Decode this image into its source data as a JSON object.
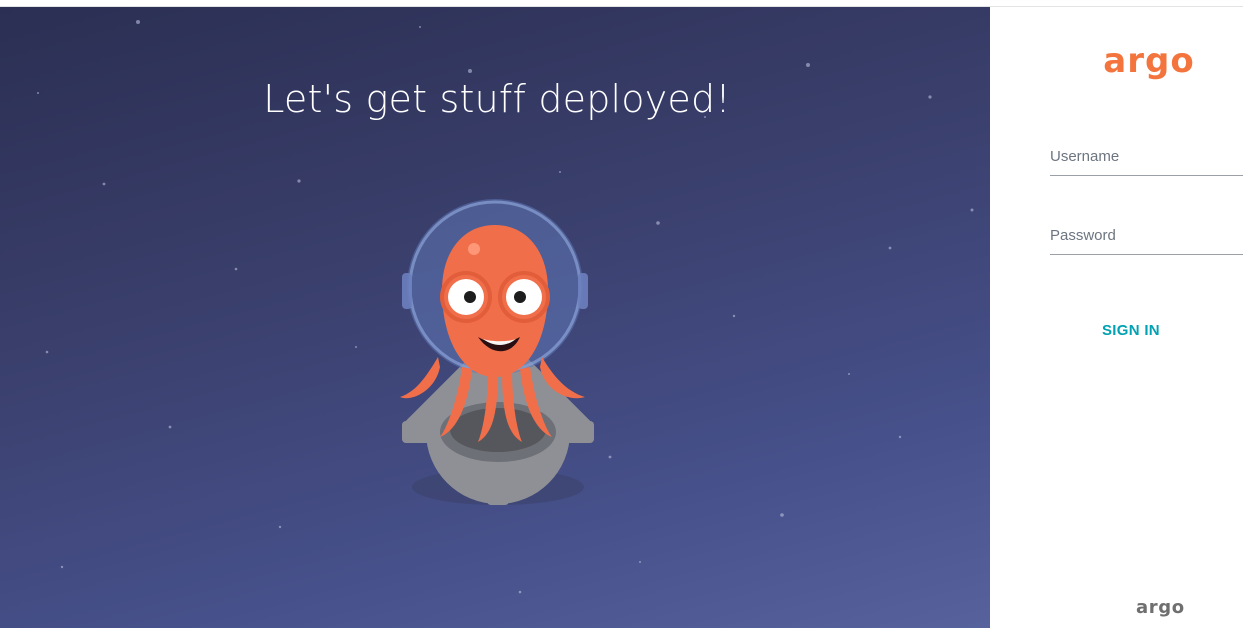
{
  "hero": {
    "title": "Let's get stuff deployed!"
  },
  "brand": {
    "logo_text": "argo",
    "footer_text": "argo",
    "accent": "#f4743e"
  },
  "form": {
    "username_placeholder": "Username",
    "password_placeholder": "Password",
    "signin_label": "SIGN IN",
    "signin_color": "#00a2b3"
  },
  "icons": {
    "mascot": "argo-octopus-mascot-icon",
    "gear": "gear-icon"
  }
}
